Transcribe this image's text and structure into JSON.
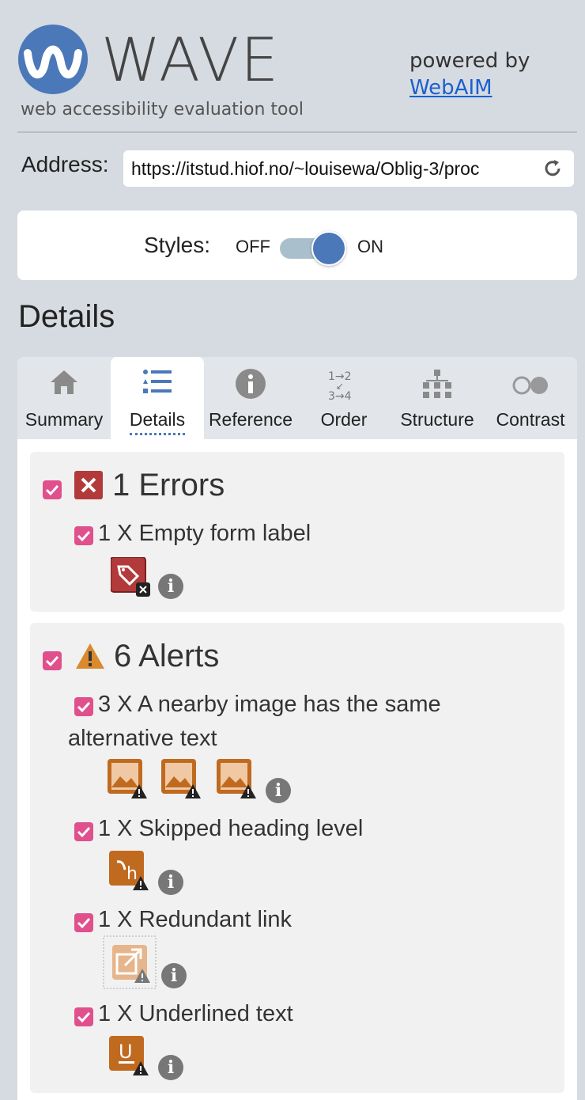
{
  "header": {
    "logo_text": "WAVE",
    "tagline": "web accessibility evaluation tool",
    "powered_by": "powered by",
    "webaim_link": "WebAIM"
  },
  "address": {
    "label": "Address:",
    "value": "https://itstud.hiof.no/~louisewa/Oblig-3/proc"
  },
  "styles": {
    "label": "Styles:",
    "off": "OFF",
    "on": "ON",
    "state": "on"
  },
  "details_heading": "Details",
  "tabs": [
    {
      "label": "Summary",
      "icon": "home-icon"
    },
    {
      "label": "Details",
      "icon": "list-icon",
      "active": true
    },
    {
      "label": "Reference",
      "icon": "info-icon"
    },
    {
      "label": "Order",
      "icon": "order-icon"
    },
    {
      "label": "Structure",
      "icon": "structure-icon"
    },
    {
      "label": "Contrast",
      "icon": "contrast-icon"
    }
  ],
  "errors": {
    "title": "1 Errors",
    "items": [
      {
        "text": "1 X Empty form label",
        "icon": "empty-label-error-icon"
      }
    ]
  },
  "alerts": {
    "title": "6 Alerts",
    "items": [
      {
        "text": "3 X A nearby image has the same alternative text",
        "icon": "image-alert-icon",
        "count": 3
      },
      {
        "text": "1 X Skipped heading level",
        "icon": "heading-alert-icon"
      },
      {
        "text": "1 X Redundant link",
        "icon": "redundant-link-icon"
      },
      {
        "text": "1 X Underlined text",
        "icon": "underline-alert-icon"
      }
    ]
  },
  "colors": {
    "accent": "#4a78b9",
    "checkbox": "#e0508c",
    "error": "#b33a3a",
    "alert": "#d9892e",
    "background": "#d6dbe1"
  }
}
